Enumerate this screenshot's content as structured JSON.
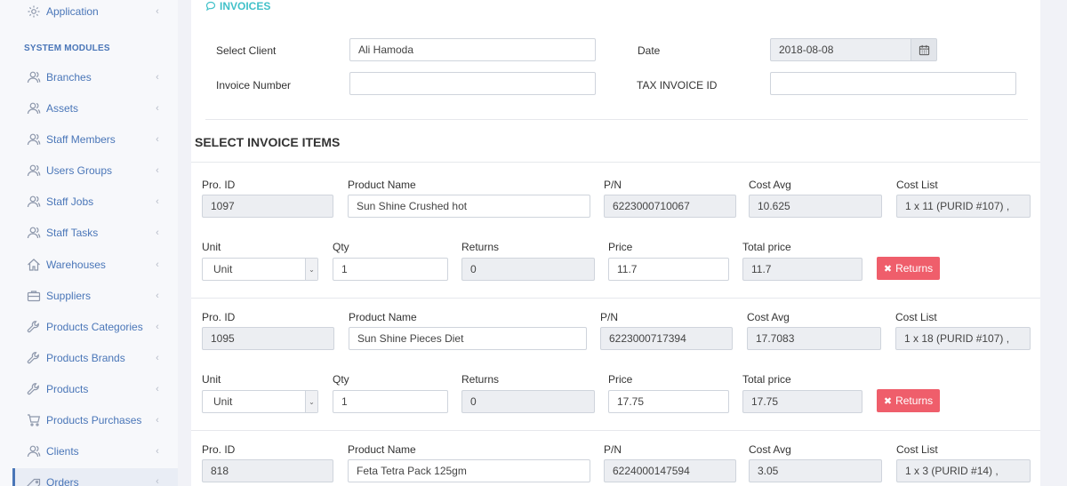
{
  "sidebar": {
    "heading": "SYSTEM MODULES",
    "items": [
      {
        "label": "Application",
        "icon": "gear-icon"
      },
      {
        "label": "Branches",
        "icon": "users-icon"
      },
      {
        "label": "Assets",
        "icon": "users-icon"
      },
      {
        "label": "Staff Members",
        "icon": "users-icon"
      },
      {
        "label": "Users Groups",
        "icon": "users-icon"
      },
      {
        "label": "Staff Jobs",
        "icon": "users-icon"
      },
      {
        "label": "Staff Tasks",
        "icon": "users-icon"
      },
      {
        "label": "Warehouses",
        "icon": "home-icon"
      },
      {
        "label": "Suppliers",
        "icon": "briefcase-icon"
      },
      {
        "label": "Products Categories",
        "icon": "wrench-icon"
      },
      {
        "label": "Products Brands",
        "icon": "wrench-icon"
      },
      {
        "label": "Products",
        "icon": "wrench-icon"
      },
      {
        "label": "Products Purchases",
        "icon": "cart-icon"
      },
      {
        "label": "Clients",
        "icon": "users-icon"
      },
      {
        "label": "Orders",
        "icon": "tag-icon"
      }
    ],
    "chevron": "‹"
  },
  "panel": {
    "title": "INVOICES"
  },
  "header_form": {
    "select_client_label": "Select Client",
    "select_client_value": "Ali Hamoda",
    "date_label": "Date",
    "date_value": "2018-08-08",
    "invoice_number_label": "Invoice Number",
    "invoice_number_value": "",
    "tax_invoice_label": "TAX INVOICE ID",
    "tax_invoice_value": ""
  },
  "items_section": {
    "title": "SELECT INVOICE ITEMS",
    "labels": {
      "pro_id": "Pro. ID",
      "product_name": "Product Name",
      "pn": "P/N",
      "cost_avg": "Cost Avg",
      "cost_list": "Cost List",
      "unit": "Unit",
      "qty": "Qty",
      "returns": "Returns",
      "price": "Price",
      "total_price": "Total price"
    },
    "returns_button": "Returns",
    "items": [
      {
        "pro_id": "1097",
        "product_name": "Sun Shine Crushed hot",
        "pn": "6223000710067",
        "cost_avg": "10.625",
        "cost_list": "1 x 11 (PURID #107) ,",
        "unit": "Unit",
        "qty": "1",
        "returns": "0",
        "price": "11.7",
        "total_price": "11.7"
      },
      {
        "pro_id": "1095",
        "product_name": "Sun Shine Pieces Diet",
        "pn": "6223000717394",
        "cost_avg": "17.7083",
        "cost_list": "1 x 18 (PURID #107) ,",
        "unit": "Unit",
        "qty": "1",
        "returns": "0",
        "price": "17.75",
        "total_price": "17.75"
      },
      {
        "pro_id": "818",
        "product_name": "Feta Tetra Pack 125gm",
        "pn": "6224000147594",
        "cost_avg": "3.05",
        "cost_list": "1 x 3 (PURID #14) ,"
      }
    ]
  },
  "colors": {
    "accent": "#4a76b8",
    "title": "#41c1c9",
    "danger": "#ef5e6b"
  }
}
